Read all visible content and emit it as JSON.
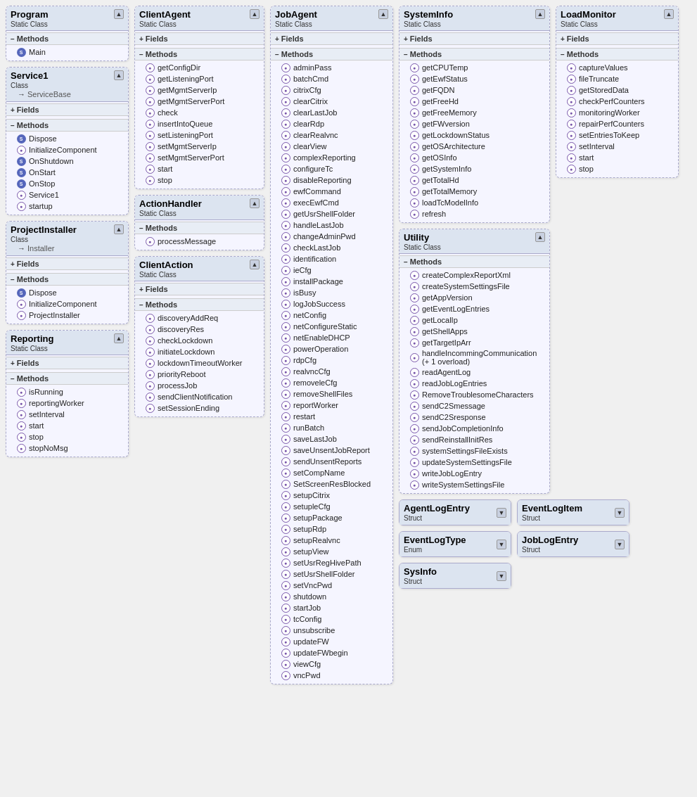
{
  "classes": {
    "program": {
      "name": "Program",
      "stereotype": "Static Class",
      "sections": [
        {
          "type": "methods",
          "label": "Methods",
          "expanded": true,
          "items": [
            {
              "name": "Main",
              "icon": "static"
            }
          ]
        }
      ]
    },
    "service1": {
      "name": "Service1",
      "stereotype": "Class",
      "inheritance": "ServiceBase",
      "sections": [
        {
          "type": "fields",
          "label": "Fields",
          "expanded": false,
          "items": []
        },
        {
          "type": "methods",
          "label": "Methods",
          "expanded": true,
          "items": [
            {
              "name": "Dispose",
              "icon": "static"
            },
            {
              "name": "InitializeComponent",
              "icon": "method"
            },
            {
              "name": "OnShutdown",
              "icon": "static"
            },
            {
              "name": "OnStart",
              "icon": "static"
            },
            {
              "name": "OnStop",
              "icon": "static"
            },
            {
              "name": "Service1",
              "icon": "method"
            },
            {
              "name": "startup",
              "icon": "method"
            }
          ]
        }
      ]
    },
    "projectInstaller": {
      "name": "ProjectInstaller",
      "stereotype": "Class",
      "inheritance": "Installer",
      "sections": [
        {
          "type": "fields",
          "label": "Fields",
          "expanded": false,
          "items": []
        },
        {
          "type": "methods",
          "label": "Methods",
          "expanded": true,
          "items": [
            {
              "name": "Dispose",
              "icon": "static"
            },
            {
              "name": "InitializeComponent",
              "icon": "method"
            },
            {
              "name": "ProjectInstaller",
              "icon": "method"
            }
          ]
        }
      ]
    },
    "reporting": {
      "name": "Reporting",
      "stereotype": "Static Class",
      "sections": [
        {
          "type": "fields",
          "label": "Fields",
          "expanded": false,
          "items": []
        },
        {
          "type": "methods",
          "label": "Methods",
          "expanded": true,
          "items": [
            {
              "name": "isRunning",
              "icon": "method"
            },
            {
              "name": "reportingWorker",
              "icon": "method"
            },
            {
              "name": "setInterval",
              "icon": "method"
            },
            {
              "name": "start",
              "icon": "method"
            },
            {
              "name": "stop",
              "icon": "method"
            },
            {
              "name": "stopNoMsg",
              "icon": "method"
            }
          ]
        }
      ]
    },
    "clientAgent": {
      "name": "ClientAgent",
      "stereotype": "Static Class",
      "sections": [
        {
          "type": "fields",
          "label": "Fields",
          "expanded": false,
          "items": []
        },
        {
          "type": "methods",
          "label": "Methods",
          "expanded": true,
          "items": [
            {
              "name": "getConfigDir",
              "icon": "method"
            },
            {
              "name": "getListeningPort",
              "icon": "method"
            },
            {
              "name": "getMgmtServerIp",
              "icon": "method"
            },
            {
              "name": "getMgmtServerPort",
              "icon": "method"
            },
            {
              "name": "check",
              "icon": "method"
            },
            {
              "name": "insertIntoQueue",
              "icon": "method"
            },
            {
              "name": "setListeningPort",
              "icon": "method"
            },
            {
              "name": "setMgmtServerIp",
              "icon": "method"
            },
            {
              "name": "setMgmtServerPort",
              "icon": "method"
            },
            {
              "name": "start",
              "icon": "method"
            },
            {
              "name": "stop",
              "icon": "method"
            }
          ]
        }
      ]
    },
    "actionHandler": {
      "name": "ActionHandler",
      "stereotype": "Static Class",
      "sections": [
        {
          "type": "methods",
          "label": "Methods",
          "expanded": true,
          "items": [
            {
              "name": "processMessage",
              "icon": "method"
            }
          ]
        }
      ]
    },
    "clientAction": {
      "name": "ClientAction",
      "stereotype": "Static Class",
      "sections": [
        {
          "type": "fields",
          "label": "Fields",
          "expanded": false,
          "items": []
        },
        {
          "type": "methods",
          "label": "Methods",
          "expanded": true,
          "items": [
            {
              "name": "discoveryAddReq",
              "icon": "method"
            },
            {
              "name": "discoveryRes",
              "icon": "method"
            },
            {
              "name": "checkLockdown",
              "icon": "method"
            },
            {
              "name": "initiateLockdown",
              "icon": "method"
            },
            {
              "name": "lockdownTimeoutWorker",
              "icon": "method"
            },
            {
              "name": "priorityReboot",
              "icon": "method"
            },
            {
              "name": "processJob",
              "icon": "method"
            },
            {
              "name": "sendClientNotification",
              "icon": "method"
            },
            {
              "name": "setSessionEnding",
              "icon": "method"
            }
          ]
        }
      ]
    },
    "jobAgent": {
      "name": "JobAgent",
      "stereotype": "Static Class",
      "sections": [
        {
          "type": "fields",
          "label": "Fields",
          "expanded": false,
          "items": []
        },
        {
          "type": "methods",
          "label": "Methods",
          "expanded": true,
          "items": [
            {
              "name": "adminPass",
              "icon": "method"
            },
            {
              "name": "batchCmd",
              "icon": "method"
            },
            {
              "name": "citrixCfg",
              "icon": "method"
            },
            {
              "name": "clearCitrix",
              "icon": "method"
            },
            {
              "name": "clearLastJob",
              "icon": "method"
            },
            {
              "name": "clearRdp",
              "icon": "method"
            },
            {
              "name": "clearRealvnc",
              "icon": "method"
            },
            {
              "name": "clearView",
              "icon": "method"
            },
            {
              "name": "complexReporting",
              "icon": "method"
            },
            {
              "name": "configureTc",
              "icon": "method"
            },
            {
              "name": "disableReporting",
              "icon": "method"
            },
            {
              "name": "ewfCommand",
              "icon": "method"
            },
            {
              "name": "execEwfCmd",
              "icon": "method"
            },
            {
              "name": "getUsrShellFolder",
              "icon": "method"
            },
            {
              "name": "handleLastJob",
              "icon": "method"
            },
            {
              "name": "changeAdminPwd",
              "icon": "method"
            },
            {
              "name": "checkLastJob",
              "icon": "method"
            },
            {
              "name": "identification",
              "icon": "method"
            },
            {
              "name": "ieCfg",
              "icon": "method"
            },
            {
              "name": "installPackage",
              "icon": "method"
            },
            {
              "name": "isBusy",
              "icon": "method"
            },
            {
              "name": "logJobSuccess",
              "icon": "method"
            },
            {
              "name": "netConfig",
              "icon": "method"
            },
            {
              "name": "netConfigureStatic",
              "icon": "method"
            },
            {
              "name": "netEnableDHCP",
              "icon": "method"
            },
            {
              "name": "powerOperation",
              "icon": "method"
            },
            {
              "name": "rdpCfg",
              "icon": "method"
            },
            {
              "name": "realvncCfg",
              "icon": "method"
            },
            {
              "name": "removeleCfg",
              "icon": "method"
            },
            {
              "name": "removeShellFiles",
              "icon": "method"
            },
            {
              "name": "reportWorker",
              "icon": "method"
            },
            {
              "name": "restart",
              "icon": "method"
            },
            {
              "name": "runBatch",
              "icon": "method"
            },
            {
              "name": "saveLastJob",
              "icon": "method"
            },
            {
              "name": "saveUnsentJobReport",
              "icon": "method"
            },
            {
              "name": "sendUnsentReports",
              "icon": "method"
            },
            {
              "name": "setCompName",
              "icon": "method"
            },
            {
              "name": "SetScreenResBlocked",
              "icon": "method"
            },
            {
              "name": "setupCitrix",
              "icon": "method"
            },
            {
              "name": "setupleCfg",
              "icon": "method"
            },
            {
              "name": "setupPackage",
              "icon": "method"
            },
            {
              "name": "setupRdp",
              "icon": "method"
            },
            {
              "name": "setupRealvnc",
              "icon": "method"
            },
            {
              "name": "setupView",
              "icon": "method"
            },
            {
              "name": "setUsrRegHivePath",
              "icon": "method"
            },
            {
              "name": "setUsrShellFolder",
              "icon": "method"
            },
            {
              "name": "setVncPwd",
              "icon": "method"
            },
            {
              "name": "shutdown",
              "icon": "method"
            },
            {
              "name": "startJob",
              "icon": "method"
            },
            {
              "name": "tcConfig",
              "icon": "method"
            },
            {
              "name": "unsubscribe",
              "icon": "method"
            },
            {
              "name": "updateFW",
              "icon": "method"
            },
            {
              "name": "updateFWbegin",
              "icon": "method"
            },
            {
              "name": "viewCfg",
              "icon": "method"
            },
            {
              "name": "vncPwd",
              "icon": "method"
            }
          ]
        }
      ]
    },
    "systemInfo": {
      "name": "SystemInfo",
      "stereotype": "Static Class",
      "sections": [
        {
          "type": "fields",
          "label": "Fields",
          "expanded": false,
          "items": []
        },
        {
          "type": "methods",
          "label": "Methods",
          "expanded": true,
          "items": [
            {
              "name": "getCPUTemp",
              "icon": "method"
            },
            {
              "name": "getEwfStatus",
              "icon": "method"
            },
            {
              "name": "getFQDN",
              "icon": "method"
            },
            {
              "name": "getFreeHd",
              "icon": "method"
            },
            {
              "name": "getFreeMemory",
              "icon": "method"
            },
            {
              "name": "getFWversion",
              "icon": "method"
            },
            {
              "name": "getLockdownStatus",
              "icon": "method"
            },
            {
              "name": "getOSArchitecture",
              "icon": "method"
            },
            {
              "name": "getOSInfo",
              "icon": "method"
            },
            {
              "name": "getSystemInfo",
              "icon": "method"
            },
            {
              "name": "getTotalHd",
              "icon": "method"
            },
            {
              "name": "getTotalMemory",
              "icon": "method"
            },
            {
              "name": "loadTcModelInfo",
              "icon": "method"
            },
            {
              "name": "refresh",
              "icon": "method"
            }
          ]
        }
      ]
    },
    "loadMonitor": {
      "name": "LoadMonitor",
      "stereotype": "Static Class",
      "sections": [
        {
          "type": "fields",
          "label": "Fields",
          "expanded": false,
          "items": []
        },
        {
          "type": "methods",
          "label": "Methods",
          "expanded": true,
          "items": [
            {
              "name": "captureValues",
              "icon": "method"
            },
            {
              "name": "fileTruncate",
              "icon": "method"
            },
            {
              "name": "getStoredData",
              "icon": "method"
            },
            {
              "name": "checkPerfCounters",
              "icon": "method"
            },
            {
              "name": "monitoringWorker",
              "icon": "method"
            },
            {
              "name": "repairPerfCounters",
              "icon": "method"
            },
            {
              "name": "setEntriesToKeep",
              "icon": "method"
            },
            {
              "name": "setInterval",
              "icon": "method"
            },
            {
              "name": "start",
              "icon": "method"
            },
            {
              "name": "stop",
              "icon": "method"
            }
          ]
        }
      ]
    },
    "utility": {
      "name": "Utility",
      "stereotype": "Static Class",
      "sections": [
        {
          "type": "methods",
          "label": "Methods",
          "expanded": true,
          "items": [
            {
              "name": "createComplexReportXml",
              "icon": "method"
            },
            {
              "name": "createSystemSettingsFile",
              "icon": "method"
            },
            {
              "name": "getAppVersion",
              "icon": "method"
            },
            {
              "name": "getEventLogEntries",
              "icon": "method"
            },
            {
              "name": "getLocalIp",
              "icon": "method"
            },
            {
              "name": "getShellApps",
              "icon": "method"
            },
            {
              "name": "getTargetIpArr",
              "icon": "method"
            },
            {
              "name": "handleIncommingCommunication (+ 1 overload)",
              "icon": "method"
            },
            {
              "name": "readAgentLog",
              "icon": "method"
            },
            {
              "name": "readJobLogEntries",
              "icon": "method"
            },
            {
              "name": "RemoveTroublesomeCharacters",
              "icon": "method"
            },
            {
              "name": "sendC2Smessage",
              "icon": "method"
            },
            {
              "name": "sendC2Sresponse",
              "icon": "method"
            },
            {
              "name": "sendJobCompletionInfo",
              "icon": "method"
            },
            {
              "name": "sendReinstallInitRes",
              "icon": "method"
            },
            {
              "name": "systemSettingsFileExists",
              "icon": "method"
            },
            {
              "name": "updateSystemSettingsFile",
              "icon": "method"
            },
            {
              "name": "writeJobLogEntry",
              "icon": "method"
            },
            {
              "name": "writeSystemSettingsFile",
              "icon": "method"
            }
          ]
        }
      ]
    }
  },
  "structs": [
    {
      "name": "AgentLogEntry",
      "stereotype": "Struct"
    },
    {
      "name": "EventLogItem",
      "stereotype": "Struct"
    },
    {
      "name": "EventLogType",
      "stereotype": "Enum"
    },
    {
      "name": "JobLogEntry",
      "stereotype": "Struct"
    },
    {
      "name": "SysInfo",
      "stereotype": "Struct"
    }
  ],
  "labels": {
    "fields": "Fields",
    "methods": "Methods",
    "expand": "+",
    "collapse": "-"
  }
}
